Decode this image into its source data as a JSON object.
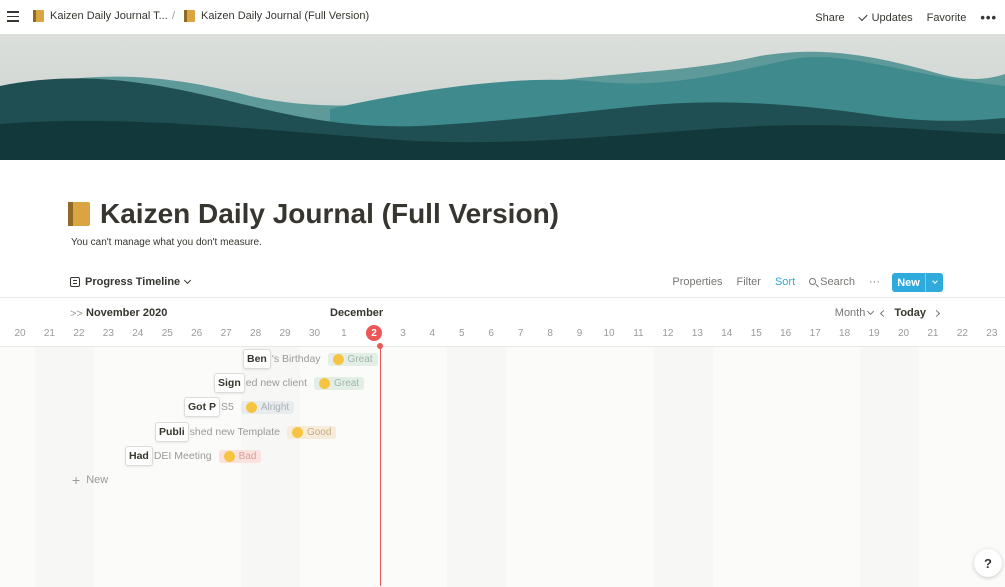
{
  "topbar": {
    "breadcrumb_parent": "Kaizen Daily Journal T...",
    "breadcrumb_separator": "/",
    "breadcrumb_current": "Kaizen Daily Journal (Full Version)",
    "share": "Share",
    "updates": "Updates",
    "favorite": "Favorite",
    "more": "•••"
  },
  "page": {
    "title": "Kaizen Daily Journal (Full Version)",
    "subtitle": "You can't manage what you don't measure.",
    "icon": "notebook-icon"
  },
  "viewbar": {
    "view_name": "Progress Timeline",
    "properties": "Properties",
    "filter": "Filter",
    "sort": "Sort",
    "search": "Search",
    "more": "···",
    "new": "New"
  },
  "timeline": {
    "month_left": "November 2020",
    "month_right": "December",
    "zoom": "Month",
    "today": "Today",
    "today_day": "2",
    "days": [
      "20",
      "21",
      "22",
      "23",
      "24",
      "25",
      "26",
      "27",
      "28",
      "29",
      "30",
      "1",
      "2",
      "3",
      "4",
      "5",
      "6",
      "7",
      "8",
      "9",
      "10",
      "11",
      "12",
      "13",
      "14",
      "15",
      "16",
      "17",
      "18",
      "19",
      "20",
      "21",
      "22",
      "23"
    ],
    "items": [
      {
        "visible": "Ben",
        "rest": "'s Birthday",
        "tag": "Great",
        "tag_class": "great"
      },
      {
        "visible": "Sign",
        "rest": "ed new client",
        "tag": "Great",
        "tag_class": "great"
      },
      {
        "visible": "Got P",
        "rest": "S5",
        "tag": "Alright",
        "tag_class": "alright"
      },
      {
        "visible": "Publi",
        "rest": "shed new Template",
        "tag": "Good",
        "tag_class": "good"
      },
      {
        "visible": "Had",
        "rest": " DEI Meeting",
        "tag": "Bad",
        "tag_class": "bad"
      }
    ],
    "add_new": "New"
  },
  "help": "?",
  "colors": {
    "accent": "#2eaadc",
    "today": "#eb5757"
  }
}
